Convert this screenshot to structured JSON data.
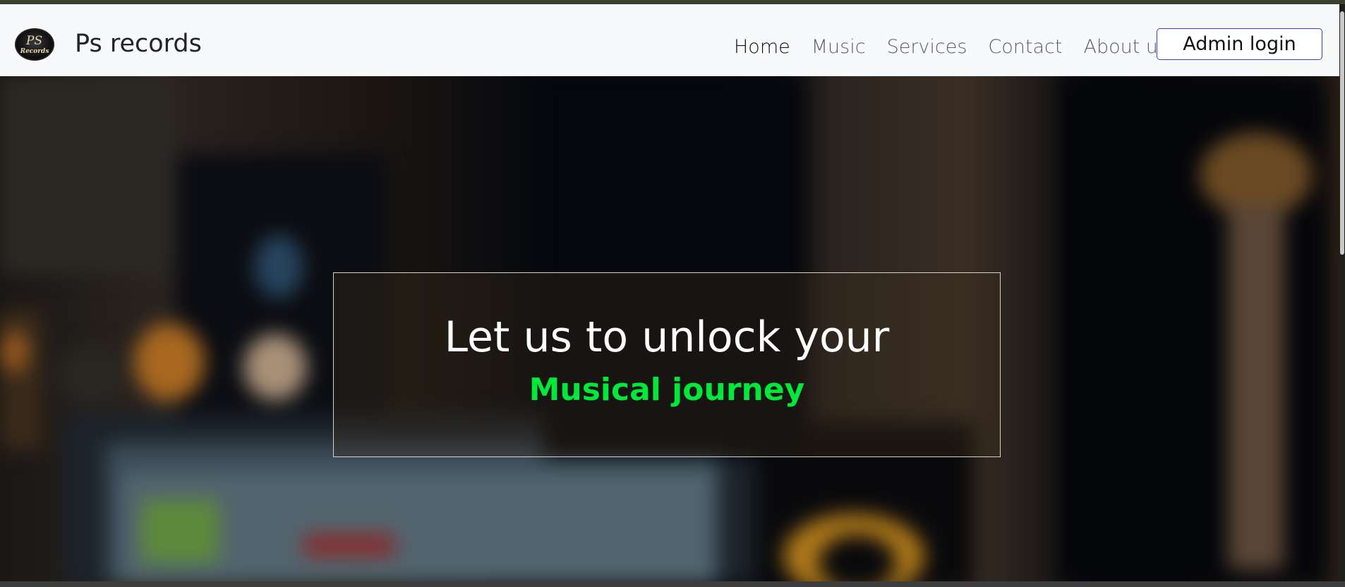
{
  "brand": {
    "name": "Ps records",
    "logo_text_top": "PS",
    "logo_text_bottom": "Records"
  },
  "nav": {
    "items": [
      {
        "label": "Home",
        "active": true
      },
      {
        "label": "Music",
        "active": false
      },
      {
        "label": "Services",
        "active": false
      },
      {
        "label": "Contact",
        "active": false
      },
      {
        "label": "About us",
        "active": false
      }
    ],
    "admin_login_label": "Admin login",
    "admin_button_border_color": "#3b3bd6"
  },
  "hero": {
    "title": "Let us to unlock your",
    "subtitle": "Musical journey",
    "subtitle_color": "#00e83a",
    "background": "blurred music studio photo"
  }
}
